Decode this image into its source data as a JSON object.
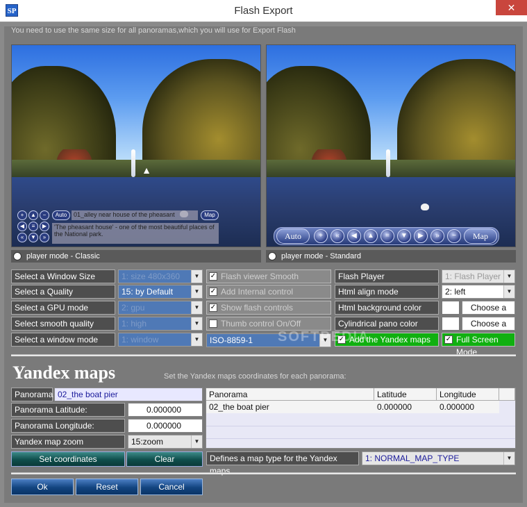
{
  "window": {
    "title": "Flash Export",
    "app_icon_text": "SP",
    "close_symbol": "✕",
    "top_note": "You need to use the same size for all panoramas,which you will use for Export Flash"
  },
  "previews": {
    "classic": {
      "radio_label": "player mode - Classic",
      "overlay_auto": "Auto",
      "overlay_title": "01_alley near house of the pheasant",
      "overlay_map": "Map",
      "overlay_desc": "'The pheasant house' - one of the most beautiful places of the National park."
    },
    "standard": {
      "radio_label": "player mode - Standard",
      "overlay_auto": "Auto",
      "overlay_map": "Map"
    }
  },
  "options": {
    "window_size_label": "Select a Window Size",
    "window_size_value": "1: size 480x360",
    "quality_label": "Select a Quality",
    "quality_value": "15: by Default",
    "gpu_label": "Select a GPU mode",
    "gpu_value": "2: gpu",
    "smooth_label": "Select smooth quality",
    "smooth_value": "1: high",
    "window_mode_label": "Select a window mode",
    "window_mode_value": "1: window",
    "flash_smooth": "Flash viewer Smooth",
    "add_internal": "Add Internal control",
    "show_flash": "Show flash controls",
    "thumb_control": "Thumb control On/Off",
    "encoding_value": "ISO-8859-1",
    "flash_player_label": "Flash Player",
    "flash_player_value": "1: Flash Player",
    "html_align_label": "Html align mode",
    "html_align_value": "2: left",
    "html_bg_label": "Html background color",
    "choose_color": "Choose a color",
    "cyl_color_label": "Cylindrical pano color",
    "add_yandex": "Add the Yandex maps",
    "full_screen": "Full Screen Mode",
    "checkmark": "✓"
  },
  "yandex": {
    "title": "Yandex maps",
    "note": "Set the Yandex maps coordinates for each panorama:",
    "panorama_label": "Panorama",
    "panorama_value": "02_the boat pier",
    "lat_label": "Panorama Latitude:",
    "lat_value": "0.000000",
    "lon_label": "Panorama Longitude:",
    "lon_value": "0.000000",
    "zoom_label": "Yandex map zoom",
    "zoom_value": "15:zoom",
    "set_coords": "Set coordinates",
    "clear": "Clear",
    "map_type_label": "Defines a map type for the Yandex maps",
    "map_type_value": "1: NORMAL_MAP_TYPE",
    "table": {
      "headers": [
        "Panorama",
        "Latitude",
        "Longitude"
      ],
      "rows": [
        [
          "02_the boat pier",
          "0.000000",
          "0.000000"
        ]
      ]
    }
  },
  "footer": {
    "ok": "Ok",
    "reset": "Reset",
    "cancel": "Cancel"
  },
  "watermark": "SOFTPEDIA"
}
